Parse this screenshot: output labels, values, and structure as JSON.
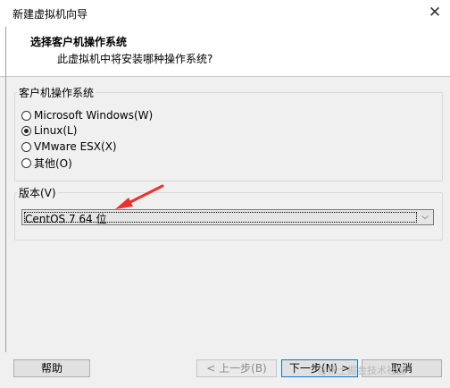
{
  "window": {
    "title": "新建虚拟机向导",
    "close_glyph": "✕"
  },
  "header": {
    "heading": "选择客户机操作系统",
    "subheading": "此虚拟机中将安装哪种操作系统?"
  },
  "guest_os": {
    "group_label": "客户机操作系统",
    "options": [
      {
        "label": "Microsoft Windows(W)",
        "selected": false
      },
      {
        "label": "Linux(L)",
        "selected": true
      },
      {
        "label": "VMware ESX(X)",
        "selected": false
      },
      {
        "label": "其他(O)",
        "selected": false
      }
    ]
  },
  "version": {
    "group_label": "版本(V)",
    "selected": "CentOS 7 64 位",
    "arrow_icon": "chevron-down-icon"
  },
  "buttons": {
    "help": "帮助",
    "back": "< 上一步(B)",
    "next": "下一步(N) >",
    "cancel": "取消"
  },
  "watermark": "@稀土掘金技术社区",
  "colors": {
    "default_button_border": "#0078d7",
    "header_background": "#ffffff",
    "dialog_background": "#f0f0f0"
  }
}
